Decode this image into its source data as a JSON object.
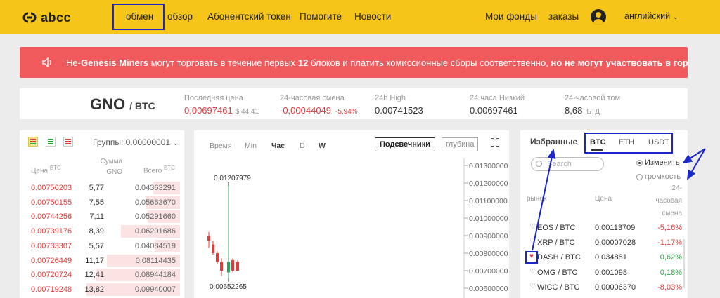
{
  "header": {
    "logo_text": "abcc",
    "nav": [
      "обмен",
      "обзор",
      "Абонентский токен",
      "Помогите",
      "Новости"
    ],
    "right": {
      "funds": "Мои фонды",
      "orders": "заказы",
      "language": "английский"
    }
  },
  "announcement": {
    "part1": "Не-",
    "part2": "Genesis Miners",
    "part3": " могут торговать в течение первых ",
    "part4": "12",
    "part5": " блоков и платить комиссионные сборы соответственно, ",
    "part6": "но не могут участвовать в горнодо"
  },
  "ticker": {
    "base": "GNO",
    "quote": "/ BTC",
    "last_price_label": "Последняя цена",
    "last_price": "0,00697461",
    "last_price_usd": "$ 44,41",
    "change_label": "24-часовая смена",
    "change": "-0,00044049",
    "change_pct": "-5,94%",
    "high_label": "24h High",
    "high": "0.00741523",
    "low_label": "24 часа Низкий",
    "low": "0.00697461",
    "volume_label": "24-часовой том",
    "volume": "8,68",
    "volume_unit": "БТД"
  },
  "orderbook": {
    "groups_label": "Группы: 0.00000001",
    "col_price": "Цена",
    "col_price_unit": "BTC",
    "col_amount": "Сумма",
    "col_amount_unit": "GNO",
    "col_total": "Всего",
    "col_total_unit": "BTC",
    "rows": [
      {
        "price": "0.00756203",
        "amount": "5,77",
        "total": "0.04363291",
        "depth": 0.27
      },
      {
        "price": "0.00750155",
        "amount": "7,55",
        "total": "0.05663670",
        "depth": 0.35
      },
      {
        "price": "0.00744256",
        "amount": "7,11",
        "total": "0.05291660",
        "depth": 0.33
      },
      {
        "price": "0.00739176",
        "amount": "8,39",
        "total": "0.06201686",
        "depth": 0.6
      },
      {
        "price": "0.00733307",
        "amount": "5,57",
        "total": "0.04084519",
        "depth": 0.26
      },
      {
        "price": "0.00726449",
        "amount": "11,17",
        "total": "0.08114435",
        "depth": 0.74
      },
      {
        "price": "0.00720724",
        "amount": "12,41",
        "total": "0.08944184",
        "depth": 0.86
      },
      {
        "price": "0.00719248",
        "amount": "13,82",
        "total": "0.09940007",
        "depth": 0.95
      }
    ]
  },
  "chart": {
    "timeframes": [
      "Время",
      "Min",
      "Час",
      "D",
      "W"
    ],
    "active_timeframes": [
      "Час",
      "W"
    ],
    "candles_label": "Подсвечники",
    "depth_label": "глубина",
    "max_label": "0.01207979",
    "min_label": "0.00652265",
    "y_ticks": [
      "0.01300000",
      "0.01200000",
      "0.01100000",
      "0.01000000",
      "0.00900000",
      "0.00800000",
      "0.00700000",
      "0.00600000"
    ]
  },
  "chart_data": {
    "type": "candlestick",
    "y_ticks": [
      0.013,
      0.012,
      0.011,
      0.01,
      0.009,
      0.008,
      0.007,
      0.006
    ],
    "ylim": [
      0.006,
      0.0132
    ],
    "candles": [
      {
        "open": 0.009,
        "high": 0.0092,
        "low": 0.0083,
        "close": 0.0087,
        "dir": "down"
      },
      {
        "open": 0.0085,
        "high": 0.0087,
        "low": 0.0079,
        "close": 0.008,
        "dir": "down"
      },
      {
        "open": 0.008,
        "high": 0.0081,
        "low": 0.0074,
        "close": 0.0075,
        "dir": "down"
      },
      {
        "open": 0.0075,
        "high": 0.0077,
        "low": 0.0067,
        "close": 0.007,
        "dir": "down"
      },
      {
        "open": 0.0069,
        "high": 0.01207979,
        "low": 0.00652265,
        "close": 0.0075,
        "dir": "up"
      },
      {
        "open": 0.0076,
        "high": 0.0077,
        "low": 0.0069,
        "close": 0.007,
        "dir": "down"
      },
      {
        "open": 0.0075,
        "high": 0.0076,
        "low": 0.007,
        "close": 0.007,
        "dir": "down"
      }
    ],
    "colors": {
      "up": "#26a65b",
      "down": "#e23b3b"
    }
  },
  "favorites": {
    "title": "Избранные",
    "tabs": [
      "BTC",
      "ETH",
      "USDT"
    ],
    "search_placeholder": "Search",
    "sort_change": "Изменить",
    "sort_volume": "громкость",
    "col_market": "рынок",
    "col_price": "Цена",
    "col_change_1": "24-",
    "col_change_2": "часовая",
    "col_change_3": "смена",
    "rows": [
      {
        "name": "EOS / BTC",
        "price": "0.00113709",
        "change": "-5,16%",
        "dir": "down",
        "fav": false
      },
      {
        "name": "XRP / BTC",
        "price": "0.00007028",
        "change": "-1,17%",
        "dir": "down",
        "fav": false
      },
      {
        "name": "DASH / BTC",
        "price": "0.034881",
        "change": "0,62%",
        "dir": "up",
        "fav": true
      },
      {
        "name": "OMG / BTC",
        "price": "0.001098",
        "change": "0,18%",
        "dir": "up",
        "fav": false
      },
      {
        "name": "WICC / BTC",
        "price": "0.00006370",
        "change": "-8,03%",
        "dir": "down",
        "fav": false
      }
    ]
  },
  "colors": {
    "brand": "#f5c51a",
    "banner": "#f15a5c",
    "annotation": "#1b27c8",
    "up": "#27a844",
    "down": "#e23b3b"
  }
}
